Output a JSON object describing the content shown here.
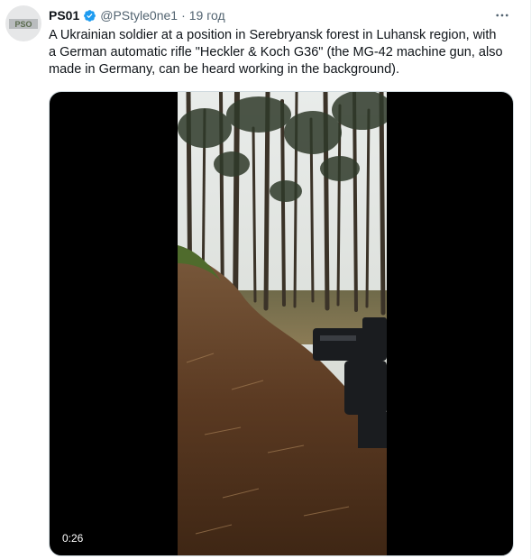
{
  "tweet": {
    "author_name": "PS01",
    "handle": "@PStyle0ne1",
    "separator": "·",
    "time": "19 год",
    "text": "A Ukrainian soldier at a position in Serebryansk forest in Luhansk region, with\na German automatic rifle \"Heckler & Koch G36\" (the MG-42 machine gun, also\nmade in Germany, can be heard working in the background).",
    "avatar_logo": "PSO",
    "verified_icon": "verified-badge-icon",
    "more_icon": "more-horizontal-icon"
  },
  "video": {
    "duration": "0:26"
  },
  "colors": {
    "text_primary": "#0f1419",
    "text_secondary": "#536471",
    "verified_blue": "#1d9bf0",
    "media_border": "#cfd9de"
  }
}
